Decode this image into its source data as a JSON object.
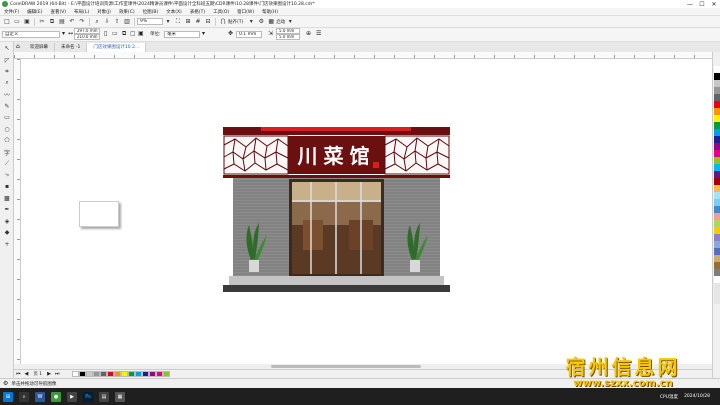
{
  "titlebar": {
    "title": "CorelDRAW 2019 (64-Bit) - E:\\平面设计培训资源\\工作室课件\\2024精讲员课件\\平面设计全科班五期\\CDR课件\\10.28课件\\门店效果图设计10.28.cdr*",
    "minimize": "—",
    "maximize": "☐",
    "close": "✕"
  },
  "menu": [
    "文件(F)",
    "编辑(E)",
    "查看(V)",
    "布局(L)",
    "对象(J)",
    "效果(C)",
    "位图(B)",
    "文本(X)",
    "表格(T)",
    "工具(O)",
    "窗口(W)",
    "帮助(H)"
  ],
  "toolbar1": {
    "zoom": "9%",
    "snap_label": "贴齐(T)",
    "launch_label": "启动"
  },
  "toolbar2": {
    "page_size": "自定义",
    "width": "297.0 mm",
    "height": "210.0 mm",
    "units_label": "单位:",
    "units": "毫米",
    "nudge": "0.1 mm",
    "dup_x": "5.0 mm",
    "dup_y": "5.0 mm"
  },
  "tabs": [
    {
      "label": "欢迎屏幕",
      "active": false
    },
    {
      "label": "未命名 -1",
      "active": false
    },
    {
      "label": "门店效果图设计10.2...",
      "active": true
    }
  ],
  "store": {
    "sign_text": "川菜馆"
  },
  "pagebar": {
    "page_label": "页 1"
  },
  "statusbar": {
    "hint": "单击并拖动可导航图像"
  },
  "taskbar": {
    "status": "CPU温度",
    "date": "2024/10/28"
  },
  "watermark": {
    "cn": "宿州信息网",
    "url": "www.szxx.com.cn"
  },
  "colors": {
    "sign_red": "#6b1010",
    "sign_bright_red": "#d81e1e",
    "wall_gray": "#8c8c8c",
    "watermark_yellow": "#f7c800"
  },
  "palette": [
    "#ffffff",
    "#000000",
    "#c8c8c8",
    "#969696",
    "#646464",
    "#e60012",
    "#f39800",
    "#fff100",
    "#009944",
    "#00a0e9",
    "#1d2088",
    "#920783",
    "#e4007f",
    "#8fc31f",
    "#00b7ee",
    "#601986",
    "#a40000",
    "#f8b551",
    "#ace0f8",
    "#7ecef4",
    "#448aca",
    "#f29c9f",
    "#b3d465",
    "#fcc800",
    "#8f82bc",
    "#88abda",
    "#556fb5",
    "#cfa972",
    "#996c33",
    "#7d7d7d",
    "#ffffff",
    "#e5e5e5",
    "#e5e5e5",
    "#e5e5e5"
  ]
}
